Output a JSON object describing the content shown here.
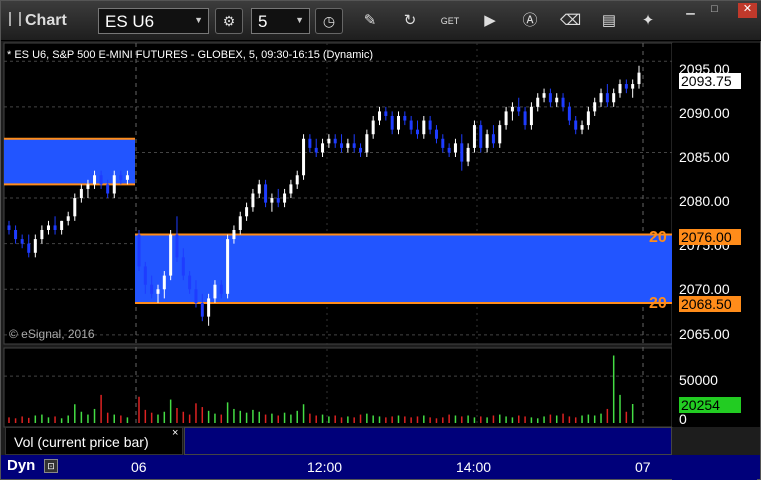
{
  "toolbar": {
    "title": "Chart",
    "symbol": "ES U6",
    "interval": "5",
    "buttons": [
      "gear-icon",
      "clock-icon",
      "pencil-icon",
      "refresh-icon",
      "get-icon",
      "play-icon",
      "letter-a-icon",
      "eraser-icon",
      "message-icon",
      "twitter-icon"
    ]
  },
  "chart": {
    "legend": "* ES U6, S&P 500 E-MINI FUTURES - GLOBEX, 5, 09:30-16:15 (Dynamic)",
    "copyright": "© eSignal, 2016",
    "colors": {
      "up": "#ffffff",
      "down": "#1e3cff",
      "zone": "#2255ff",
      "zone_border": "#ff8c1a",
      "last_price_bg": "#ffffff",
      "volume_up": "#44dd44",
      "volume_down": "#dd2222",
      "volume_value_bg": "#22cc22"
    },
    "price_ticks": [
      "2095.00",
      "2090.00",
      "2085.00",
      "2080.00",
      "2075.00",
      "2070.00",
      "2065.00"
    ],
    "last_price": "2093.75",
    "zone_upper_price": "2076.00",
    "zone_lower_price": "2068.50",
    "zone_upper_tag": "20",
    "zone_lower_tag": "20",
    "volume_ticks": [
      "50000",
      "0"
    ],
    "volume_value": "20254",
    "x_ticks": [
      "06",
      "12:00",
      "14:00",
      "07"
    ]
  },
  "subpane": {
    "label": "Vol (current price bar)",
    "close": "×"
  },
  "status": {
    "dyn": "Dyn"
  },
  "chart_data": {
    "type": "candlestick",
    "title": "ES U6, S&P 500 E-MINI FUTURES - GLOBEX, 5, 09:30-16:15 (Dynamic)",
    "ylim": [
      2064,
      2097
    ],
    "candles": [
      {
        "o": 2077,
        "h": 2077.5,
        "l": 2076,
        "c": 2076.5
      },
      {
        "o": 2076.5,
        "h": 2077,
        "l": 2075,
        "c": 2075.5
      },
      {
        "o": 2075.5,
        "h": 2076,
        "l": 2074.5,
        "c": 2075
      },
      {
        "o": 2075,
        "h": 2076,
        "l": 2073.5,
        "c": 2074
      },
      {
        "o": 2074,
        "h": 2076,
        "l": 2073.5,
        "c": 2075.5
      },
      {
        "o": 2075.5,
        "h": 2077,
        "l": 2075,
        "c": 2076.5
      },
      {
        "o": 2076.5,
        "h": 2077.5,
        "l": 2076,
        "c": 2077
      },
      {
        "o": 2077,
        "h": 2078,
        "l": 2076,
        "c": 2076.5
      },
      {
        "o": 2076.5,
        "h": 2077.5,
        "l": 2076,
        "c": 2077.5
      },
      {
        "o": 2077.5,
        "h": 2078.5,
        "l": 2077,
        "c": 2078
      },
      {
        "o": 2078,
        "h": 2080.5,
        "l": 2077.5,
        "c": 2080
      },
      {
        "o": 2080,
        "h": 2081.5,
        "l": 2079.5,
        "c": 2081
      },
      {
        "o": 2081,
        "h": 2082,
        "l": 2080,
        "c": 2081.5
      },
      {
        "o": 2081.5,
        "h": 2083,
        "l": 2081,
        "c": 2082.5
      },
      {
        "o": 2082.5,
        "h": 2083,
        "l": 2081,
        "c": 2081.5
      },
      {
        "o": 2081.5,
        "h": 2082,
        "l": 2080,
        "c": 2080.5
      },
      {
        "o": 2080.5,
        "h": 2083,
        "l": 2080,
        "c": 2082.5
      },
      {
        "o": 2082.5,
        "h": 2083,
        "l": 2081.5,
        "c": 2082
      },
      {
        "o": 2082,
        "h": 2083,
        "l": 2081.5,
        "c": 2082.5
      },
      {
        "o": 2076,
        "h": 2076.5,
        "l": 2072,
        "c": 2072.5
      },
      {
        "o": 2072.5,
        "h": 2073,
        "l": 2069.5,
        "c": 2070.5
      },
      {
        "o": 2070.5,
        "h": 2071.5,
        "l": 2069,
        "c": 2069.5
      },
      {
        "o": 2069.5,
        "h": 2070.5,
        "l": 2068.5,
        "c": 2070
      },
      {
        "o": 2070,
        "h": 2072,
        "l": 2069,
        "c": 2071.5
      },
      {
        "o": 2071.5,
        "h": 2076.5,
        "l": 2071,
        "c": 2076
      },
      {
        "o": 2076,
        "h": 2078,
        "l": 2073,
        "c": 2073.5
      },
      {
        "o": 2073.5,
        "h": 2074.5,
        "l": 2071,
        "c": 2071.5
      },
      {
        "o": 2071.5,
        "h": 2072,
        "l": 2069.5,
        "c": 2070
      },
      {
        "o": 2070,
        "h": 2071,
        "l": 2068,
        "c": 2068.5
      },
      {
        "o": 2068.5,
        "h": 2069.5,
        "l": 2066.5,
        "c": 2067
      },
      {
        "o": 2067,
        "h": 2069.5,
        "l": 2066,
        "c": 2069
      },
      {
        "o": 2069,
        "h": 2071,
        "l": 2068.5,
        "c": 2070.5
      },
      {
        "o": 2070.5,
        "h": 2071,
        "l": 2069,
        "c": 2069.5
      },
      {
        "o": 2069.5,
        "h": 2076,
        "l": 2069,
        "c": 2075.5
      },
      {
        "o": 2075.5,
        "h": 2077,
        "l": 2075,
        "c": 2076.5
      },
      {
        "o": 2076.5,
        "h": 2078.5,
        "l": 2076,
        "c": 2078
      },
      {
        "o": 2078,
        "h": 2079.5,
        "l": 2077.5,
        "c": 2079
      },
      {
        "o": 2079,
        "h": 2081,
        "l": 2078.5,
        "c": 2080.5
      },
      {
        "o": 2080.5,
        "h": 2082,
        "l": 2080,
        "c": 2081.5
      },
      {
        "o": 2081.5,
        "h": 2082,
        "l": 2079,
        "c": 2079.5
      },
      {
        "o": 2079.5,
        "h": 2080.5,
        "l": 2078.5,
        "c": 2080
      },
      {
        "o": 2080,
        "h": 2081,
        "l": 2079,
        "c": 2079.5
      },
      {
        "o": 2079.5,
        "h": 2081,
        "l": 2079,
        "c": 2080.5
      },
      {
        "o": 2080.5,
        "h": 2082,
        "l": 2080,
        "c": 2081.5
      },
      {
        "o": 2081.5,
        "h": 2083,
        "l": 2081,
        "c": 2082.5
      },
      {
        "o": 2082.5,
        "h": 2087,
        "l": 2082,
        "c": 2086.5
      },
      {
        "o": 2086.5,
        "h": 2087,
        "l": 2085,
        "c": 2085.5
      },
      {
        "o": 2085.5,
        "h": 2086.5,
        "l": 2084.5,
        "c": 2085
      },
      {
        "o": 2085,
        "h": 2086.5,
        "l": 2084.5,
        "c": 2086
      },
      {
        "o": 2086,
        "h": 2087,
        "l": 2085.5,
        "c": 2086.5
      },
      {
        "o": 2086.5,
        "h": 2087,
        "l": 2085.5,
        "c": 2086
      },
      {
        "o": 2086,
        "h": 2087,
        "l": 2085,
        "c": 2085.5
      },
      {
        "o": 2085.5,
        "h": 2086.5,
        "l": 2085,
        "c": 2086
      },
      {
        "o": 2086,
        "h": 2087,
        "l": 2085,
        "c": 2085.5
      },
      {
        "o": 2085.5,
        "h": 2086,
        "l": 2084.5,
        "c": 2085
      },
      {
        "o": 2085,
        "h": 2087.5,
        "l": 2084.5,
        "c": 2087
      },
      {
        "o": 2087,
        "h": 2089,
        "l": 2086.5,
        "c": 2088.5
      },
      {
        "o": 2088.5,
        "h": 2090,
        "l": 2088,
        "c": 2089.5
      },
      {
        "o": 2089.5,
        "h": 2090,
        "l": 2088.5,
        "c": 2089
      },
      {
        "o": 2089,
        "h": 2089.5,
        "l": 2087,
        "c": 2087.5
      },
      {
        "o": 2087.5,
        "h": 2089.5,
        "l": 2087,
        "c": 2089
      },
      {
        "o": 2089,
        "h": 2089.5,
        "l": 2088,
        "c": 2088.5
      },
      {
        "o": 2088.5,
        "h": 2089,
        "l": 2087,
        "c": 2087.5
      },
      {
        "o": 2087.5,
        "h": 2088.5,
        "l": 2086.5,
        "c": 2087
      },
      {
        "o": 2087,
        "h": 2089,
        "l": 2086.5,
        "c": 2088.5
      },
      {
        "o": 2088.5,
        "h": 2089,
        "l": 2087,
        "c": 2087.5
      },
      {
        "o": 2087.5,
        "h": 2088,
        "l": 2086,
        "c": 2086.5
      },
      {
        "o": 2086.5,
        "h": 2087,
        "l": 2085,
        "c": 2085.5
      },
      {
        "o": 2085.5,
        "h": 2086,
        "l": 2084.5,
        "c": 2085
      },
      {
        "o": 2085,
        "h": 2086.5,
        "l": 2084.5,
        "c": 2086
      },
      {
        "o": 2086,
        "h": 2087,
        "l": 2083,
        "c": 2084
      },
      {
        "o": 2084,
        "h": 2086,
        "l": 2083.5,
        "c": 2085.5
      },
      {
        "o": 2085.5,
        "h": 2088.5,
        "l": 2085,
        "c": 2088
      },
      {
        "o": 2088,
        "h": 2088.5,
        "l": 2085,
        "c": 2085.5
      },
      {
        "o": 2085.5,
        "h": 2087.5,
        "l": 2085,
        "c": 2087
      },
      {
        "o": 2087,
        "h": 2088,
        "l": 2085.5,
        "c": 2086
      },
      {
        "o": 2086,
        "h": 2088.5,
        "l": 2085.5,
        "c": 2088
      },
      {
        "o": 2088,
        "h": 2090,
        "l": 2087.5,
        "c": 2089.5
      },
      {
        "o": 2089.5,
        "h": 2090.5,
        "l": 2088.5,
        "c": 2090
      },
      {
        "o": 2090,
        "h": 2091,
        "l": 2089,
        "c": 2089.5
      },
      {
        "o": 2089.5,
        "h": 2090,
        "l": 2087.5,
        "c": 2088
      },
      {
        "o": 2088,
        "h": 2090.5,
        "l": 2087.5,
        "c": 2090
      },
      {
        "o": 2090,
        "h": 2091.5,
        "l": 2089.5,
        "c": 2091
      },
      {
        "o": 2091,
        "h": 2092,
        "l": 2090.5,
        "c": 2091.5
      },
      {
        "o": 2091.5,
        "h": 2092,
        "l": 2090,
        "c": 2090.5
      },
      {
        "o": 2090.5,
        "h": 2091.5,
        "l": 2090,
        "c": 2091
      },
      {
        "o": 2091,
        "h": 2091.5,
        "l": 2089.5,
        "c": 2090
      },
      {
        "o": 2090,
        "h": 2090.5,
        "l": 2088,
        "c": 2088.5
      },
      {
        "o": 2088.5,
        "h": 2089,
        "l": 2087,
        "c": 2087.5
      },
      {
        "o": 2087.5,
        "h": 2088.5,
        "l": 2087,
        "c": 2088
      },
      {
        "o": 2088,
        "h": 2090,
        "l": 2087.5,
        "c": 2089.5
      },
      {
        "o": 2089.5,
        "h": 2091,
        "l": 2089,
        "c": 2090.5
      },
      {
        "o": 2090.5,
        "h": 2092,
        "l": 2090,
        "c": 2091.5
      },
      {
        "o": 2091.5,
        "h": 2092.5,
        "l": 2090,
        "c": 2090.5
      },
      {
        "o": 2090.5,
        "h": 2092,
        "l": 2090,
        "c": 2091.5
      },
      {
        "o": 2091.5,
        "h": 2093,
        "l": 2091,
        "c": 2092.5
      },
      {
        "o": 2092.5,
        "h": 2093,
        "l": 2091.5,
        "c": 2092
      },
      {
        "o": 2092,
        "h": 2093,
        "l": 2091,
        "c": 2092.5
      },
      {
        "o": 2092.5,
        "h": 2094.5,
        "l": 2092,
        "c": 2093.75
      }
    ],
    "volume_ylim": [
      0,
      80000
    ],
    "volume": [
      6000,
      5000,
      7000,
      5500,
      8000,
      9000,
      6000,
      7000,
      5000,
      8000,
      20000,
      12000,
      9000,
      15000,
      30000,
      11000,
      9000,
      8000,
      6000,
      28000,
      14000,
      11000,
      9000,
      12000,
      25000,
      16000,
      12000,
      9000,
      21000,
      17000,
      13000,
      10000,
      9000,
      22000,
      15000,
      13000,
      11000,
      14000,
      12000,
      9000,
      10000,
      8000,
      11000,
      9000,
      13000,
      20000,
      10000,
      8000,
      9000,
      7000,
      8000,
      6000,
      7000,
      6000,
      9000,
      10000,
      8000,
      7000,
      6000,
      7000,
      8000,
      7000,
      6000,
      7000,
      8000,
      6000,
      5000,
      6000,
      9000,
      8000,
      7000,
      8000,
      6000,
      7000,
      6000,
      8000,
      9000,
      7000,
      6000,
      8000,
      7000,
      6000,
      5000,
      7000,
      9000,
      8000,
      10000,
      7000,
      6000,
      8000,
      9000,
      8000,
      10000,
      15000,
      72000,
      30000,
      12000,
      20254
    ],
    "zones": [
      {
        "from": 2081.5,
        "to": 2086.5,
        "x_range": "06 open-06"
      },
      {
        "from": 2068.5,
        "to": 2076.0,
        "x_range": "06-07"
      }
    ]
  }
}
